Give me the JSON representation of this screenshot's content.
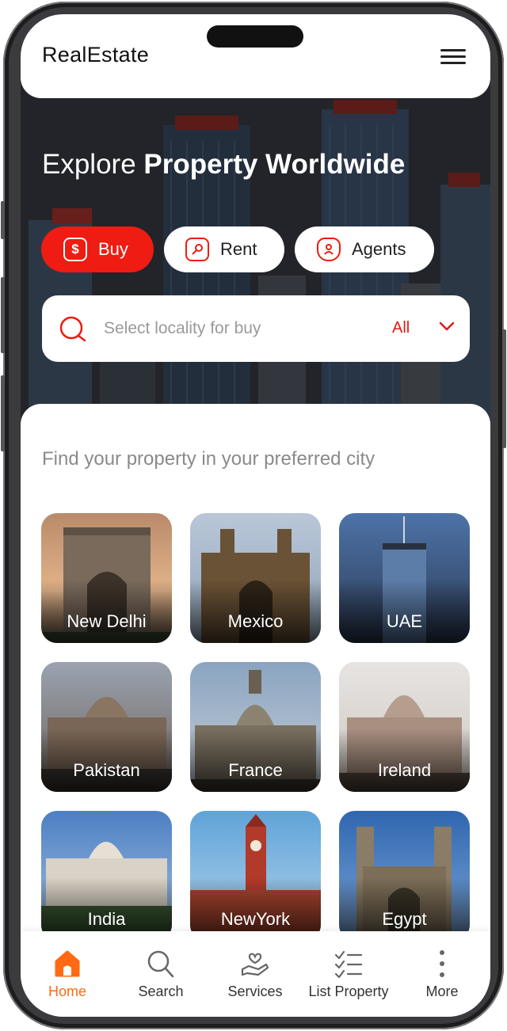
{
  "app": {
    "title": "RealEstate"
  },
  "hero": {
    "headline_prefix": "Explore",
    "headline_bold": "Property Worldwide"
  },
  "tabs": [
    {
      "label": "Buy",
      "icon": "dollar-icon",
      "active": true
    },
    {
      "label": "Rent",
      "icon": "key-icon",
      "active": false
    },
    {
      "label": "Agents",
      "icon": "agent-icon",
      "active": false
    }
  ],
  "search": {
    "placeholder": "Select locality for buy",
    "filter_value": "All"
  },
  "cities_section": {
    "title": "Find your property in your preferred city",
    "cities": [
      {
        "name": "New Delhi"
      },
      {
        "name": "Mexico"
      },
      {
        "name": "UAE"
      },
      {
        "name": "Pakistan"
      },
      {
        "name": "France"
      },
      {
        "name": "Ireland"
      },
      {
        "name": "India"
      },
      {
        "name": "NewYork"
      },
      {
        "name": "Egypt"
      }
    ]
  },
  "bottom_nav": [
    {
      "label": "Home",
      "icon": "home-icon",
      "active": true
    },
    {
      "label": "Search",
      "icon": "search-icon",
      "active": false
    },
    {
      "label": "Services",
      "icon": "services-icon",
      "active": false
    },
    {
      "label": "List Property",
      "icon": "list-icon",
      "active": false
    },
    {
      "label": "More",
      "icon": "more-icon",
      "active": false
    }
  ],
  "colors": {
    "primary_red": "#ee1c12",
    "nav_active": "#ff6a13"
  }
}
